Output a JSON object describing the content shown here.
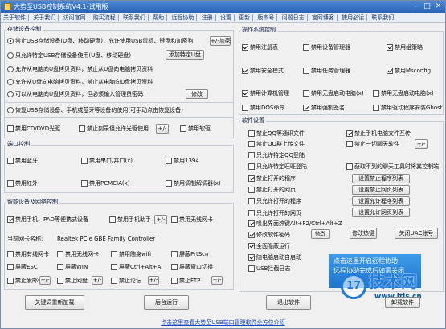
{
  "title": "大势至USB控制系统V4.1-试用版",
  "menu": [
    "关于软件",
    "关于我们",
    "访问官网",
    "购买流程",
    "联系我们",
    "帮助",
    "远程协助",
    "注册",
    "设置",
    "更新",
    "版本号",
    "问题日志",
    "官网博客",
    "使用必读",
    "联系我们"
  ],
  "storage": {
    "title": "存储设备控制",
    "opt1": "禁止USB存储设备(U盘、移动硬盘)，允许使用USB鼠标、键盘和加密狗",
    "opt1_btn": "+/-加密",
    "opt2": "只允许特定USB存储设备使用(U盘、移动硬盘)",
    "opt2_btn": "添加特定U盘",
    "opt3": "允许从电脑向U盘拷贝资料，禁止从U盘向电脑拷贝资料",
    "opt4": "允许从U盘向电脑拷贝资料，禁止从电脑向U盘拷贝资料",
    "opt5": "可以从电脑向U盘拷贝资料，但必须输入管理员密码",
    "opt5_btn": "修改",
    "opt6": "恢复USB存储设备、手机或蓝牙等设备的使用(可手动点击恢复设备)",
    "cd": "禁用CD/DVD光驱",
    "cd2": "禁止刻录但允许光驱使用",
    "cd2_btn": "+/-",
    "floppy": "禁用软驱"
  },
  "port": {
    "title": "端口控制",
    "items": [
      "禁用蓝牙",
      "禁用串口/并口(x)",
      "禁用1394",
      "禁用红外",
      "禁用PCMCIA(x)",
      "禁用调制解调器(x)"
    ]
  },
  "smart": {
    "title": "智能设备及网络控制",
    "phone": "禁用手机、PAD等便携式设备",
    "phone2": "禁用手机助手",
    "phone2_btn": "+/-",
    "phone3": "禁用无线网卡",
    "nic_label": "当前网卡名称:",
    "nic_value": "Realtek PCIe GBE Family Controller",
    "items": [
      "禁用有线网卡",
      "禁用无线网卡",
      "禁用随身wifi",
      "屏蔽PrtScn",
      "屏蔽ESC",
      "屏蔽WIN",
      "屏蔽Ctrl+Alt+A",
      "屏蔽窗口切换",
      "禁止发邮件",
      "禁止网盘",
      "禁止论坛",
      "禁止FTP"
    ],
    "plus": "+/-"
  },
  "system": {
    "title": "操作系统控制",
    "items": [
      "禁用注册表",
      "禁用设备管理器",
      "禁用组策略",
      "禁用安全模式",
      "禁用任务管理器",
      "禁用Msconfig",
      "禁用计算机管理",
      "禁用无盘启动电脑(x)",
      "禁用无盘启动电脑(x)",
      "禁用DOS命令",
      "禁用强制签名",
      "禁用驱动程序安装Ghost"
    ]
  },
  "software": {
    "title": "软件设置",
    "qq1": "禁止QQ等通讯文件",
    "qq2": "禁止QQ群上传文件",
    "qq3": "只允许特定QQ登陆",
    "qq4": "只允许特定旺旺登陆",
    "qq5": "禁止打开的程序",
    "qq6": "禁止打开的网页",
    "qq7": "只允许打开的程序",
    "qq8": "只允许打开的网页",
    "r1": "禁止手机电脑文件互传",
    "r2": "禁止一切聊天软件",
    "r2_btn": "+/-",
    "r3": "获取不到的聊天工具时将其控制端",
    "hotkey": "唤出界面热键Alt+F2/Ctrl+Alt+Z",
    "pwd": "修改软件密码",
    "pwd_btn": "修改",
    "hide": "全面隐蔽运行",
    "boot": "随电脑启动自启动",
    "usblog": "USB拦截日志",
    "btns": [
      "设置禁止程序列表",
      "设置禁止网页列表",
      "设置允许程序列表",
      "设置允许网页列表"
    ],
    "hotkey_btn": "修改热键",
    "uac_btn": "关闭UAC账号"
  },
  "ad_text": "点击这里开启远程协助\n远程协助完成后如需关闭",
  "watermark": {
    "logo": "17",
    "text": "技术网",
    "url": "www.itjs.cn"
  },
  "uninstall_btn": "卸载软件",
  "bottom": {
    "b1": "关键词重新加载",
    "b2": "后台运行",
    "b3": "退出软件"
  },
  "footer": "点击这里查看大势至USB端口管理软件全方位介绍"
}
